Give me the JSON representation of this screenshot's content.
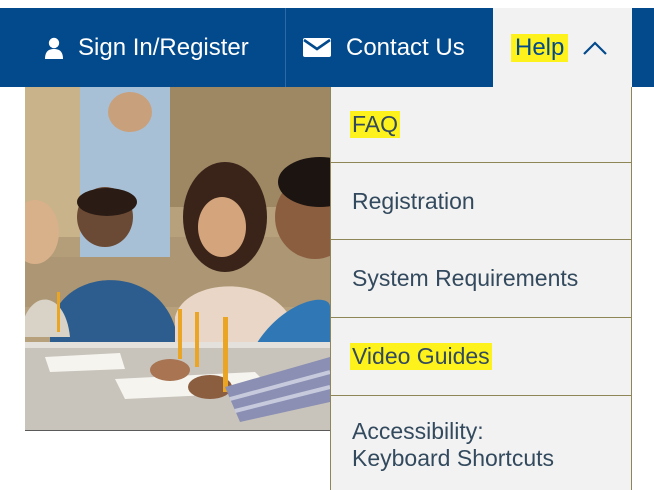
{
  "nav": {
    "sign_in": {
      "label": "Sign In/Register",
      "icon": "user-icon"
    },
    "contact": {
      "label": "Contact Us",
      "icon": "envelope-icon"
    },
    "help": {
      "label": "Help",
      "icon": "chevron-up-icon",
      "expanded": true
    }
  },
  "help_menu": {
    "items": [
      {
        "label": "FAQ",
        "highlighted": true
      },
      {
        "label": "Registration",
        "highlighted": false
      },
      {
        "label": "System Requirements",
        "highlighted": false
      },
      {
        "label": "Video Guides",
        "highlighted": true
      },
      {
        "label_line1": "Accessibility:",
        "label_line2": "Keyboard Shortcuts",
        "highlighted": false
      }
    ]
  },
  "colors": {
    "nav_bg": "#034a8c",
    "dropdown_bg": "#f2f2f2",
    "highlight": "#fdf21b",
    "menu_text": "#334a5e",
    "divider": "#8f8658"
  },
  "hero_image": {
    "subject": "students-writing-in-classroom-photo"
  }
}
